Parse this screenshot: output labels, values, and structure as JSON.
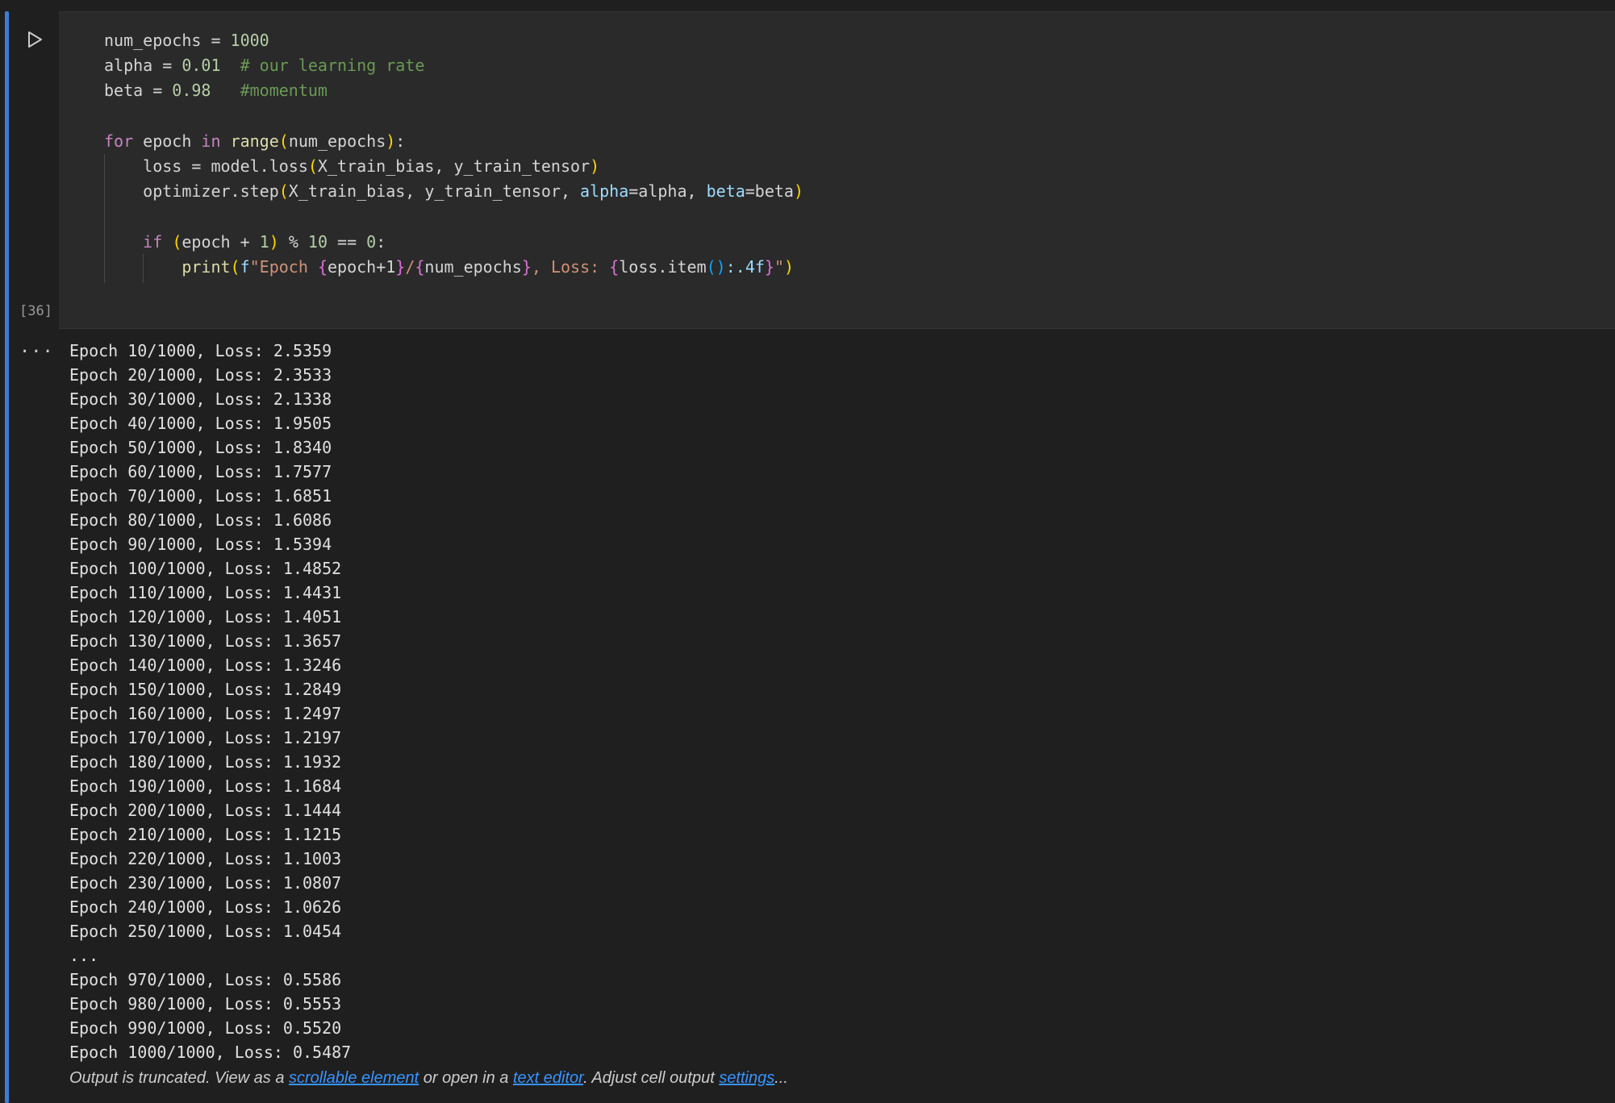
{
  "cell": {
    "execution_count": "[36]",
    "run_icon": "play-icon",
    "code_lines": [
      [
        {
          "t": "num_epochs = ",
          "c": ""
        },
        {
          "t": "1000",
          "c": "t-num"
        }
      ],
      [
        {
          "t": "alpha = ",
          "c": ""
        },
        {
          "t": "0.01",
          "c": "t-num"
        },
        {
          "t": "  # our learning rate",
          "c": "t-cmt"
        }
      ],
      [
        {
          "t": "beta = ",
          "c": ""
        },
        {
          "t": "0.98",
          "c": "t-num"
        },
        {
          "t": "   #momentum",
          "c": "t-cmt"
        }
      ],
      [],
      [
        {
          "t": "for",
          "c": "t-kw"
        },
        {
          "t": " epoch ",
          "c": ""
        },
        {
          "t": "in",
          "c": "t-kw"
        },
        {
          "t": " ",
          "c": ""
        },
        {
          "t": "range",
          "c": "t-fn"
        },
        {
          "t": "(",
          "c": "t-par"
        },
        {
          "t": "num_epochs",
          "c": ""
        },
        {
          "t": ")",
          "c": "t-par"
        },
        {
          "t": ":",
          "c": ""
        }
      ],
      [
        {
          "t": "    loss = model.loss",
          "c": ""
        },
        {
          "t": "(",
          "c": "t-par"
        },
        {
          "t": "X_train_bias, y_train_tensor",
          "c": ""
        },
        {
          "t": ")",
          "c": "t-par"
        }
      ],
      [
        {
          "t": "    optimizer.step",
          "c": ""
        },
        {
          "t": "(",
          "c": "t-par"
        },
        {
          "t": "X_train_bias, y_train_tensor, ",
          "c": ""
        },
        {
          "t": "alpha",
          "c": "t-kwarg"
        },
        {
          "t": "=alpha, ",
          "c": ""
        },
        {
          "t": "beta",
          "c": "t-kwarg"
        },
        {
          "t": "=beta",
          "c": ""
        },
        {
          "t": ")",
          "c": "t-par"
        }
      ],
      [],
      [
        {
          "t": "    ",
          "c": ""
        },
        {
          "t": "if",
          "c": "t-kw"
        },
        {
          "t": " ",
          "c": ""
        },
        {
          "t": "(",
          "c": "t-par"
        },
        {
          "t": "epoch + ",
          "c": ""
        },
        {
          "t": "1",
          "c": "t-num"
        },
        {
          "t": ")",
          "c": "t-par"
        },
        {
          "t": " % ",
          "c": ""
        },
        {
          "t": "10",
          "c": "t-num"
        },
        {
          "t": " == ",
          "c": ""
        },
        {
          "t": "0",
          "c": "t-num"
        },
        {
          "t": ":",
          "c": ""
        }
      ],
      [
        {
          "t": "        ",
          "c": ""
        },
        {
          "t": "print",
          "c": "t-fn"
        },
        {
          "t": "(",
          "c": "t-par"
        },
        {
          "t": "f",
          "c": "t-kwarg"
        },
        {
          "t": "\"Epoch ",
          "c": "t-str"
        },
        {
          "t": "{",
          "c": "t-par2"
        },
        {
          "t": "epoch+1",
          "c": ""
        },
        {
          "t": "}",
          "c": "t-par2"
        },
        {
          "t": "/",
          "c": "t-str"
        },
        {
          "t": "{",
          "c": "t-par2"
        },
        {
          "t": "num_epochs",
          "c": ""
        },
        {
          "t": "}",
          "c": "t-par2"
        },
        {
          "t": ", Loss: ",
          "c": "t-str"
        },
        {
          "t": "{",
          "c": "t-par2"
        },
        {
          "t": "loss.item",
          "c": ""
        },
        {
          "t": "()",
          "c": "t-par3"
        },
        {
          "t": ":.4f",
          "c": "t-kwarg"
        },
        {
          "t": "}",
          "c": "t-par2"
        },
        {
          "t": "\"",
          "c": "t-str"
        },
        {
          "t": ")",
          "c": "t-par"
        }
      ]
    ]
  },
  "output": {
    "menu_label": "···",
    "lines": [
      "Epoch 10/1000, Loss: 2.5359",
      "Epoch 20/1000, Loss: 2.3533",
      "Epoch 30/1000, Loss: 2.1338",
      "Epoch 40/1000, Loss: 1.9505",
      "Epoch 50/1000, Loss: 1.8340",
      "Epoch 60/1000, Loss: 1.7577",
      "Epoch 70/1000, Loss: 1.6851",
      "Epoch 80/1000, Loss: 1.6086",
      "Epoch 90/1000, Loss: 1.5394",
      "Epoch 100/1000, Loss: 1.4852",
      "Epoch 110/1000, Loss: 1.4431",
      "Epoch 120/1000, Loss: 1.4051",
      "Epoch 130/1000, Loss: 1.3657",
      "Epoch 140/1000, Loss: 1.3246",
      "Epoch 150/1000, Loss: 1.2849",
      "Epoch 160/1000, Loss: 1.2497",
      "Epoch 170/1000, Loss: 1.2197",
      "Epoch 180/1000, Loss: 1.1932",
      "Epoch 190/1000, Loss: 1.1684",
      "Epoch 200/1000, Loss: 1.1444",
      "Epoch 210/1000, Loss: 1.1215",
      "Epoch 220/1000, Loss: 1.1003",
      "Epoch 230/1000, Loss: 1.0807",
      "Epoch 240/1000, Loss: 1.0626",
      "Epoch 250/1000, Loss: 1.0454",
      "...",
      "Epoch 970/1000, Loss: 0.5586",
      "Epoch 980/1000, Loss: 0.5553",
      "Epoch 990/1000, Loss: 0.5520",
      "Epoch 1000/1000, Loss: 0.5487"
    ],
    "truncation": {
      "prefix": "Output is truncated. View as a ",
      "link_scrollable": "scrollable element",
      "middle": " or open in a ",
      "link_editor": "text editor",
      "suffix_before_settings": ". Adjust cell output ",
      "link_settings": "settings",
      "suffix": "..."
    }
  },
  "colors": {
    "accent": "#3b7ed6",
    "link": "#3794ff",
    "background": "#1f1f1f",
    "editor_background": "#2a2a2a"
  }
}
